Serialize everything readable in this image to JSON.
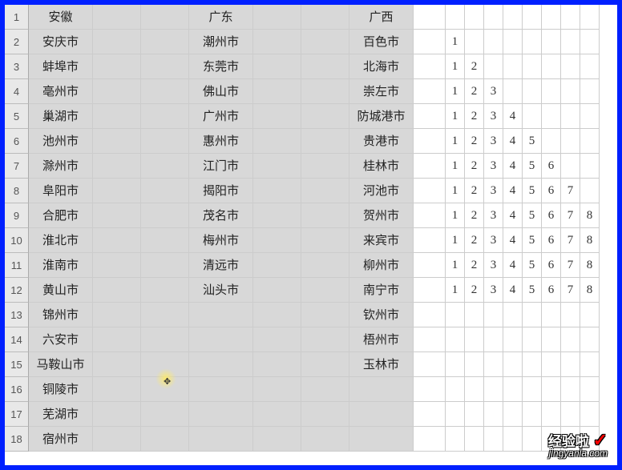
{
  "rows": [
    {
      "num": "1",
      "b": "安徽",
      "e": "广东",
      "h": "广西",
      "nums": [
        "",
        "",
        "",
        "",
        "",
        "",
        "",
        ""
      ]
    },
    {
      "num": "2",
      "b": "安庆市",
      "e": "潮州市",
      "h": "百色市",
      "nums": [
        "1",
        "",
        "",
        "",
        "",
        "",
        "",
        ""
      ]
    },
    {
      "num": "3",
      "b": "蚌埠市",
      "e": "东莞市",
      "h": "北海市",
      "nums": [
        "1",
        "2",
        "",
        "",
        "",
        "",
        "",
        ""
      ]
    },
    {
      "num": "4",
      "b": "亳州市",
      "e": "佛山市",
      "h": "崇左市",
      "nums": [
        "1",
        "2",
        "3",
        "",
        "",
        "",
        "",
        ""
      ]
    },
    {
      "num": "5",
      "b": "巢湖市",
      "e": "广州市",
      "h": "防城港市",
      "nums": [
        "1",
        "2",
        "3",
        "4",
        "",
        "",
        "",
        ""
      ]
    },
    {
      "num": "6",
      "b": "池州市",
      "e": "惠州市",
      "h": "贵港市",
      "nums": [
        "1",
        "2",
        "3",
        "4",
        "5",
        "",
        "",
        ""
      ]
    },
    {
      "num": "7",
      "b": "滁州市",
      "e": "江门市",
      "h": "桂林市",
      "nums": [
        "1",
        "2",
        "3",
        "4",
        "5",
        "6",
        "",
        ""
      ]
    },
    {
      "num": "8",
      "b": "阜阳市",
      "e": "揭阳市",
      "h": "河池市",
      "nums": [
        "1",
        "2",
        "3",
        "4",
        "5",
        "6",
        "7",
        ""
      ]
    },
    {
      "num": "9",
      "b": "合肥市",
      "e": "茂名市",
      "h": "贺州市",
      "nums": [
        "1",
        "2",
        "3",
        "4",
        "5",
        "6",
        "7",
        "8"
      ]
    },
    {
      "num": "10",
      "b": "淮北市",
      "e": "梅州市",
      "h": "来宾市",
      "nums": [
        "1",
        "2",
        "3",
        "4",
        "5",
        "6",
        "7",
        "8"
      ]
    },
    {
      "num": "11",
      "b": "淮南市",
      "e": "清远市",
      "h": "柳州市",
      "nums": [
        "1",
        "2",
        "3",
        "4",
        "5",
        "6",
        "7",
        "8"
      ]
    },
    {
      "num": "12",
      "b": "黄山市",
      "e": "汕头市",
      "h": "南宁市",
      "nums": [
        "1",
        "2",
        "3",
        "4",
        "5",
        "6",
        "7",
        "8"
      ]
    },
    {
      "num": "13",
      "b": "锦州市",
      "e": "",
      "h": "钦州市",
      "nums": [
        "",
        "",
        "",
        "",
        "",
        "",
        "",
        ""
      ]
    },
    {
      "num": "14",
      "b": "六安市",
      "e": "",
      "h": "梧州市",
      "nums": [
        "",
        "",
        "",
        "",
        "",
        "",
        "",
        ""
      ]
    },
    {
      "num": "15",
      "b": "马鞍山市",
      "e": "",
      "h": "玉林市",
      "nums": [
        "",
        "",
        "",
        "",
        "",
        "",
        "",
        ""
      ]
    },
    {
      "num": "16",
      "b": "铜陵市",
      "e": "",
      "h": "",
      "nums": [
        "",
        "",
        "",
        "",
        "",
        "",
        "",
        ""
      ]
    },
    {
      "num": "17",
      "b": "芜湖市",
      "e": "",
      "h": "",
      "nums": [
        "",
        "",
        "",
        "",
        "",
        "",
        "",
        ""
      ]
    },
    {
      "num": "18",
      "b": "宿州市",
      "e": "",
      "h": "",
      "nums": [
        "",
        "",
        "",
        "",
        "",
        "",
        "",
        ""
      ]
    }
  ],
  "watermark": {
    "text": "经验啦",
    "check": "✓",
    "domain": "jingyanla.com"
  }
}
